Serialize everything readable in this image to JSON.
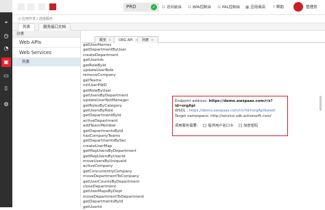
{
  "leftbar": {
    "icons": [
      "location-icon",
      "clock-icon",
      "gauge-icon",
      "toolbox-icon",
      "display-icon",
      "phone-icon",
      "gear-icon"
    ]
  },
  "topbar": {
    "env": "PRD",
    "nav": [
      {
        "icon": "☷",
        "label": "访问前台"
      },
      {
        "icon": "☷",
        "label": "BPA控制台"
      },
      {
        "icon": "☷",
        "label": "PAL控制台"
      },
      {
        "icon": "▦",
        "label": "应用商店"
      },
      {
        "icon": "?",
        "label": "帮助"
      }
    ],
    "user": "管理员"
  },
  "breadcrumb": "◷  应用开发 / 连接服务",
  "outer_tabs": [
    "列表",
    "服务接口文档"
  ],
  "sidebar": {
    "header": "分类",
    "groups": [
      "Web APIs",
      "Web Services"
    ],
    "selected_item": "列表"
  },
  "inner_tabs": [
    {
      "label": "概览"
    },
    {
      "label": "ORG API"
    },
    {
      "label": "列表"
    }
  ],
  "methods": [
    "getUserNames",
    "getDepartmentByUser",
    "createDepartment",
    "getUserIds",
    "getRoleById",
    "updateUserRole",
    "removeCompany",
    "getTeams",
    "initUserPWD",
    "getRoleByUser",
    "getUsersByDepartment",
    "updateUserNotManager",
    "getRolesByCategory",
    "getUsersByRole",
    "getDepartmentById",
    "activeDepartment",
    "addTeamMember",
    "getDepartmentsById",
    "hasCompanyTeams",
    "getDepartmentsBySec",
    "createUserMap",
    "getMapUsersByDepartment",
    "getMapUsersByUserid",
    "moveUsersByUniqueId",
    "activeCompany",
    "getConcurrentlyCompany",
    "moveDepartmentToCompany",
    "getUserCountsByDepartment",
    "closeDepartment",
    "getUserMapsByDept",
    "moveDepartmentToDepartment",
    "getDepartmentsById",
    "getUserId"
  ],
  "info": {
    "endpoint_label": "Endpoint address:",
    "endpoint_value": "https://demo.awspaas.com/r/s?id=orgApi",
    "wsdl_label": "WSDL :",
    "wsdl_value": "https://demo.awspaas.com/r/s?id=orgApi&wsdl",
    "namespace_label": "Target namespace:",
    "namespace_value": "http://service.sdk.actionsoft.com/",
    "need_label": "调用服务需要:",
    "option1": "提供用户名口令",
    "option2": "加密密码"
  }
}
